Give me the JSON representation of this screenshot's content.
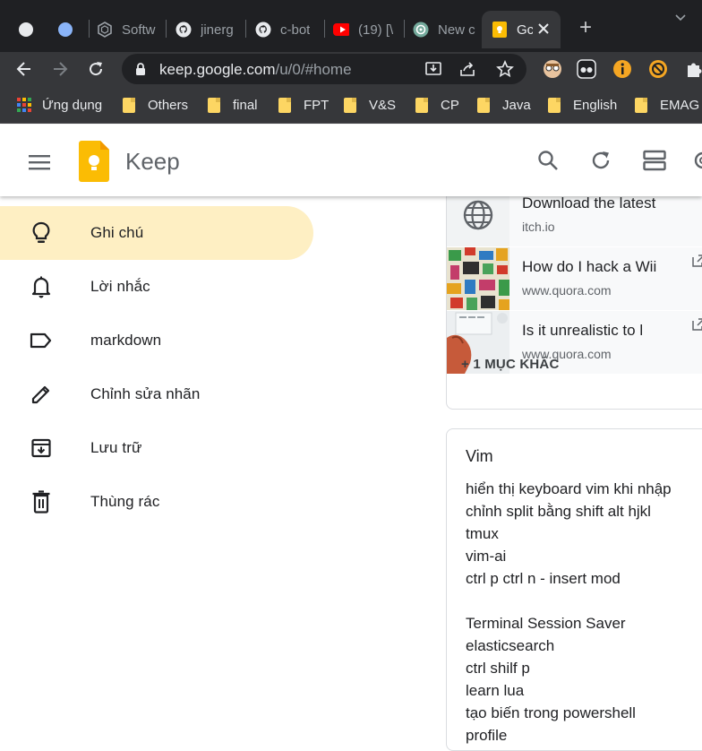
{
  "browser": {
    "tabs": [
      {
        "title": "",
        "favicon": "circle-gray-icon"
      },
      {
        "title": "",
        "favicon": "circle-blue-icon"
      },
      {
        "title": "Softw",
        "favicon": "hexagon-icon"
      },
      {
        "title": "jinerg",
        "favicon": "github-icon"
      },
      {
        "title": "c-bot",
        "favicon": "github-icon"
      },
      {
        "title": "(19) [\\",
        "favicon": "youtube-icon"
      },
      {
        "title": "New c",
        "favicon": "openai-icon"
      },
      {
        "title": "Gc",
        "favicon": "keep-icon",
        "active": true
      }
    ],
    "new_tab_label": "+",
    "address": {
      "host": "keep.google.com",
      "path": "/u/0/#home"
    },
    "bookmarks": [
      {
        "label": "Ứng dụng",
        "icon": "apps-grid-icon"
      },
      {
        "label": "Others"
      },
      {
        "label": "final"
      },
      {
        "label": "FPT"
      },
      {
        "label": "V&S"
      },
      {
        "label": "CP"
      },
      {
        "label": "Java"
      },
      {
        "label": "English"
      },
      {
        "label": "EMAG I"
      }
    ]
  },
  "keep": {
    "product_name": "Keep",
    "nav": [
      {
        "label": "Ghi chú",
        "icon": "lightbulb-icon",
        "active": true
      },
      {
        "label": "Lời nhắc",
        "icon": "bell-icon"
      },
      {
        "label": "markdown",
        "icon": "label-icon"
      },
      {
        "label": "Chỉnh sửa nhãn",
        "icon": "pencil-icon"
      },
      {
        "label": "Lưu trữ",
        "icon": "archive-icon"
      },
      {
        "label": "Thùng rác",
        "icon": "trash-icon"
      }
    ],
    "links": [
      {
        "title": "Download the latest",
        "domain": "itch.io",
        "thumb": "globe-icon"
      },
      {
        "title": "How do I hack a Wii",
        "domain": "www.quora.com",
        "thumb": "comic-image"
      },
      {
        "title": "Is it unrealistic to l",
        "domain": "www.quora.com",
        "thumb": "hand-photo"
      }
    ],
    "more_items": "+ 1 MỤC KHÁC",
    "vim_note": {
      "title": "Vim",
      "body": "hiển thị keyboard vim khi nhập\nchỉnh split bằng shift alt hjkl\ntmux\nvim-ai\nctrl p ctrl n - insert mod\n\nTerminal Session Saver\nelasticsearch\nctrl shilf p\nlearn lua\ntạo biến trong powershell\nprofile"
    }
  },
  "colors": {
    "active_nav_bg": "#feefc3",
    "keep_yellow": "#fbbc04",
    "chrome_dark": "#202124"
  }
}
